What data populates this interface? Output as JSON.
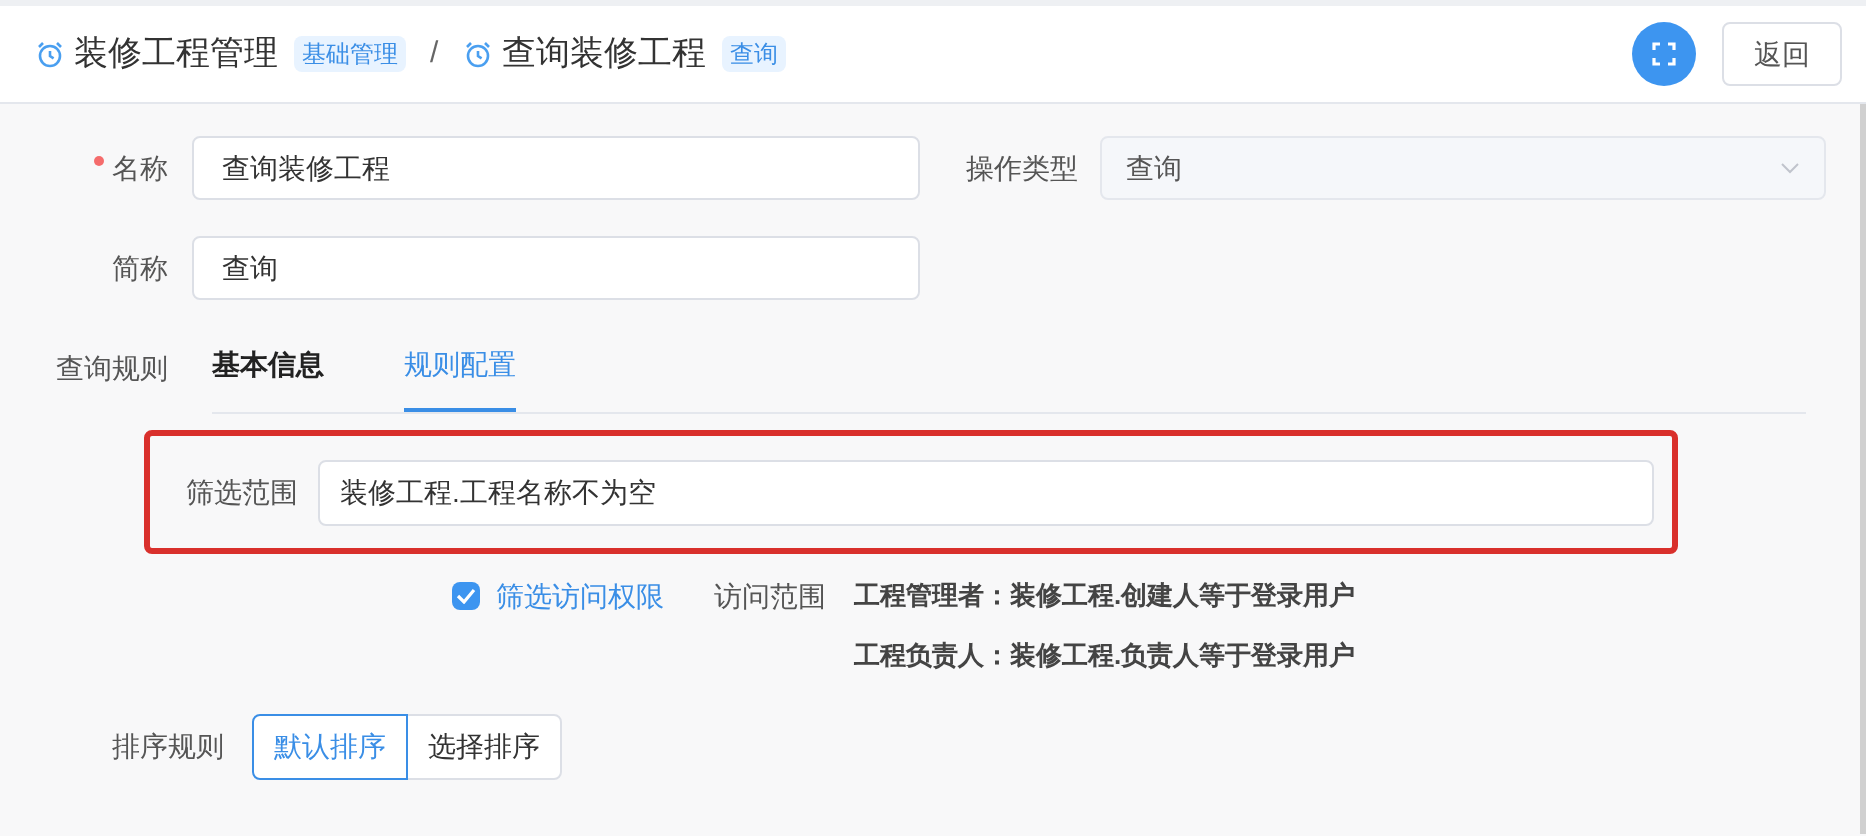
{
  "breadcrumb": [
    {
      "title": "装修工程管理",
      "tag": "基础管理"
    },
    {
      "title": "查询装修工程",
      "tag": "查询"
    }
  ],
  "separator": "/",
  "back_button": "返回",
  "form": {
    "name": {
      "label": "名称",
      "required": true,
      "value": "查询装修工程"
    },
    "operation_type": {
      "label": "操作类型",
      "value": "查询",
      "disabled": true
    },
    "short_name": {
      "label": "简称",
      "value": "查询"
    },
    "query_rules": {
      "label": "查询规则",
      "tabs": [
        {
          "label": "基本信息",
          "selected": false
        },
        {
          "label": "规则配置",
          "selected": true
        }
      ],
      "filter_scope": {
        "label": "筛选范围",
        "value": "装修工程.工程名称不为空",
        "highlighted": true
      },
      "access_filter": {
        "label": "筛选访问权限",
        "checked": true
      },
      "access_scope": {
        "label": "访问范围",
        "rules": [
          "工程管理者：装修工程.创建人等于登录用户",
          "工程负责人：装修工程.负责人等于登录用户"
        ]
      },
      "sort": {
        "label": "排序规则",
        "options": [
          {
            "label": "默认排序",
            "selected": true
          },
          {
            "label": "选择排序",
            "selected": false
          }
        ]
      }
    }
  }
}
